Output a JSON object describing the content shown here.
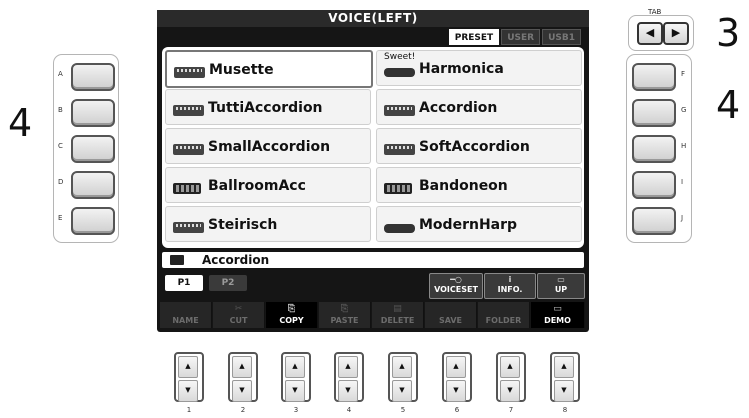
{
  "callouts": {
    "left": "4",
    "right": "4",
    "tab": "3"
  },
  "tab_label": "TAB",
  "tab_buttons": {
    "left_glyph": "◀",
    "right_glyph": "▶"
  },
  "left_buttons": [
    "A",
    "B",
    "C",
    "D",
    "E"
  ],
  "right_buttons": [
    "F",
    "G",
    "H",
    "I",
    "J"
  ],
  "screen": {
    "title": "VOICE(LEFT)",
    "bank_tabs": [
      {
        "label": "PRESET",
        "active": true
      },
      {
        "label": "USER",
        "active": false
      },
      {
        "label": "USB1",
        "active": false
      }
    ],
    "voices_left": [
      {
        "name": "Musette",
        "selected": true,
        "icon": "accordion-icon"
      },
      {
        "name": "TuttiAccordion",
        "selected": false,
        "icon": "accordion-icon"
      },
      {
        "name": "SmallAccordion",
        "selected": false,
        "icon": "accordion-icon"
      },
      {
        "name": "BallroomAcc",
        "selected": false,
        "icon": "bandoneon-icon"
      },
      {
        "name": "Steirisch",
        "selected": false,
        "icon": "accordion-icon"
      }
    ],
    "voices_right": [
      {
        "name": "Harmonica",
        "tag": "Sweet!",
        "icon": "harmonica-icon"
      },
      {
        "name": "Accordion",
        "icon": "accordion-icon"
      },
      {
        "name": "SoftAccordion",
        "icon": "accordion-icon"
      },
      {
        "name": "Bandoneon",
        "icon": "bandoneon-icon"
      },
      {
        "name": "ModernHarp",
        "icon": "harmonica-icon"
      }
    ],
    "folder": "Accordion",
    "pages": [
      {
        "label": "P1",
        "active": true
      },
      {
        "label": "P2",
        "active": false
      }
    ],
    "upper_buttons": [
      {
        "label": "VOICESET",
        "glyph": "━○"
      },
      {
        "label": "INFO.",
        "glyph": "i"
      },
      {
        "label": "UP",
        "glyph": "▭"
      }
    ],
    "function_buttons": [
      {
        "label": "NAME",
        "glyph": "",
        "enabled": false
      },
      {
        "label": "CUT",
        "glyph": "✂",
        "enabled": false
      },
      {
        "label": "COPY",
        "glyph": "⎘",
        "enabled": true
      },
      {
        "label": "PASTE",
        "glyph": "⎘",
        "enabled": false
      },
      {
        "label": "DELETE",
        "glyph": "▤",
        "enabled": false
      },
      {
        "label": "SAVE",
        "glyph": "",
        "enabled": false
      },
      {
        "label": "FOLDER",
        "glyph": "",
        "enabled": false
      },
      {
        "label": "DEMO",
        "glyph": "▭",
        "enabled": true
      }
    ]
  },
  "bottom_buttons": [
    {
      "num": "1",
      "up": "▲",
      "down": "▼"
    },
    {
      "num": "2",
      "up": "▲",
      "down": "▼"
    },
    {
      "num": "3",
      "up": "▲",
      "down": "▼"
    },
    {
      "num": "4",
      "up": "▲",
      "down": "▼"
    },
    {
      "num": "5",
      "up": "▲",
      "down": "▼"
    },
    {
      "num": "6",
      "up": "▲",
      "down": "▼"
    },
    {
      "num": "7",
      "up": "▲",
      "down": "▼"
    },
    {
      "num": "8",
      "up": "▲",
      "down": "▼"
    }
  ]
}
